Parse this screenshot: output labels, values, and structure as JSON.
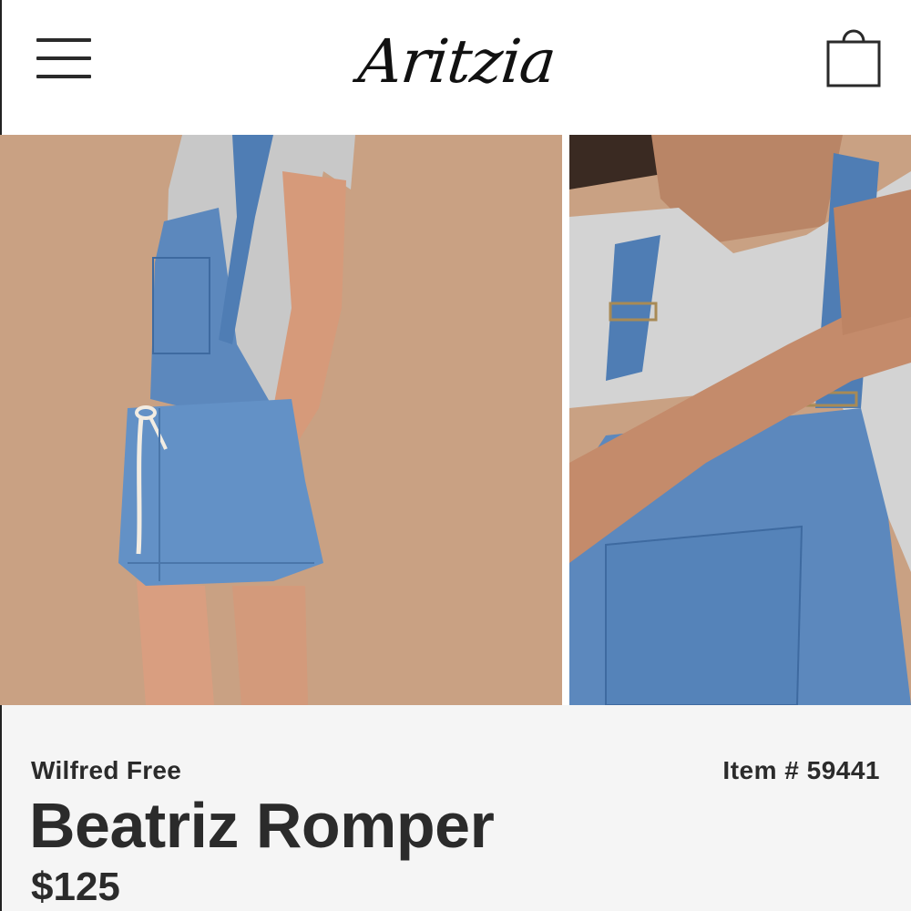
{
  "header": {
    "logo_text": "Aritzia",
    "menu_icon": "hamburger-menu-icon",
    "bag_icon": "shopping-bag-icon"
  },
  "gallery": {
    "images": [
      {
        "description": "full product photo",
        "icon": "product-photo"
      },
      {
        "description": "detail photo",
        "icon": "product-detail-photo"
      }
    ]
  },
  "product": {
    "brand": "Wilfred Free",
    "item_number": "Item # 59441",
    "name": "Beatriz Romper",
    "price": "$125"
  },
  "colors": {
    "background": "#ffffff",
    "info_background": "#f5f5f5",
    "photo_background": "#c9a183",
    "text": "#2b2b2b"
  }
}
